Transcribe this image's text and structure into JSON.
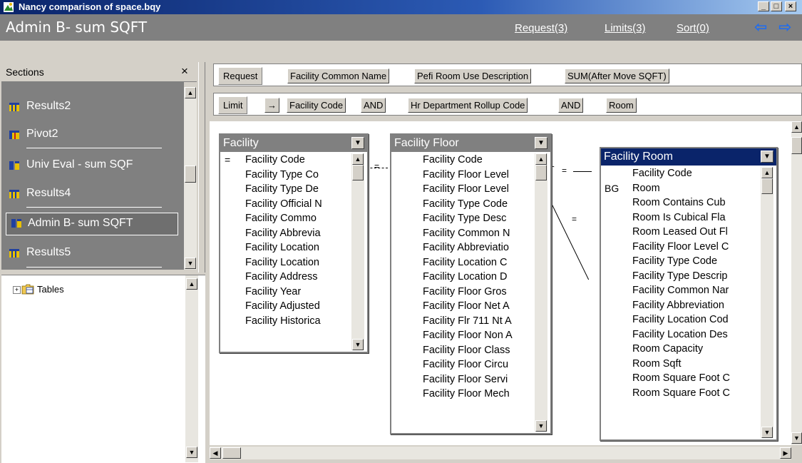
{
  "window": {
    "title": "Nancy comparison of space.bqy",
    "controls": {
      "minimize": "_",
      "maximize": "□",
      "close": "×"
    }
  },
  "header": {
    "title": "Admin B- sum SQFT",
    "links": {
      "request": "Request(3)",
      "limits": "Limits(3)",
      "sort": "Sort(0)"
    },
    "nav": {
      "back": "⇦",
      "forward": "⇨"
    }
  },
  "sections": {
    "title": "Sections",
    "close": "×",
    "items": [
      {
        "label": "Results2",
        "icon": "results-icon"
      },
      {
        "label": "Pivot2",
        "icon": "pivot-icon"
      },
      {
        "label": "Univ Eval - sum SQF",
        "icon": "query-icon"
      },
      {
        "label": "Results4",
        "icon": "results-icon"
      },
      {
        "label": "Admin B- sum SQFT",
        "icon": "query-icon",
        "selected": true
      },
      {
        "label": "Results5",
        "icon": "results-icon"
      }
    ]
  },
  "tree": {
    "expander": "+",
    "root": "Tables"
  },
  "request_bar": {
    "label": "Request",
    "items": [
      "Facility Common Name",
      "Pefi Room Use Description",
      "SUM(After Move SQFT)"
    ]
  },
  "limit_bar": {
    "label": "Limit",
    "arrow": "→",
    "items": [
      "Facility Code",
      "AND",
      "Hr Department Rollup Code",
      "AND",
      "Room"
    ]
  },
  "topics": {
    "facility": {
      "title": "Facility",
      "fields": [
        {
          "mark": "=",
          "name": "Facility Code"
        },
        {
          "mark": "",
          "name": "Facility Type Co"
        },
        {
          "mark": "",
          "name": "Facility Type De"
        },
        {
          "mark": "",
          "name": "Facility Official N"
        },
        {
          "mark": "",
          "name": "Facility Commo"
        },
        {
          "mark": "",
          "name": "Facility Abbrevia"
        },
        {
          "mark": "",
          "name": "Facility Location"
        },
        {
          "mark": "",
          "name": "Facility Location"
        },
        {
          "mark": "",
          "name": "Facility Address"
        },
        {
          "mark": "",
          "name": "Facility Year"
        },
        {
          "mark": "",
          "name": "Facility Adjusted"
        },
        {
          "mark": "",
          "name": "Facility Historica"
        }
      ]
    },
    "floor": {
      "title": "Facility Floor",
      "fields": [
        {
          "mark": "",
          "name": "Facility Code"
        },
        {
          "mark": "",
          "name": "Facility Floor Level"
        },
        {
          "mark": "",
          "name": "Facility Floor Level"
        },
        {
          "mark": "",
          "name": "Facility Type Code"
        },
        {
          "mark": "",
          "name": "Facility Type Desc"
        },
        {
          "mark": "",
          "name": "Facility Common N"
        },
        {
          "mark": "",
          "name": "Facility Abbreviatio"
        },
        {
          "mark": "",
          "name": "Facility Location C"
        },
        {
          "mark": "",
          "name": "Facility Location D"
        },
        {
          "mark": "",
          "name": "Facility Floor Gros"
        },
        {
          "mark": "",
          "name": "Facility Floor Net A"
        },
        {
          "mark": "",
          "name": "Facility Flr 711 Nt A"
        },
        {
          "mark": "",
          "name": "Facility Floor Non A"
        },
        {
          "mark": "",
          "name": "Facility Floor Class"
        },
        {
          "mark": "",
          "name": "Facility Floor Circu"
        },
        {
          "mark": "",
          "name": "Facility Floor Servi"
        },
        {
          "mark": "",
          "name": "Facility Floor Mech"
        }
      ]
    },
    "room": {
      "title": "Facility Room",
      "fields": [
        {
          "mark": "",
          "name": "Facility Code"
        },
        {
          "mark": "BG",
          "name": "Room"
        },
        {
          "mark": "",
          "name": "Room Contains Cub"
        },
        {
          "mark": "",
          "name": "Room Is Cubical Fla"
        },
        {
          "mark": "",
          "name": "Room Leased Out Fl"
        },
        {
          "mark": "",
          "name": "Facility Floor Level C"
        },
        {
          "mark": "",
          "name": "Facility Type Code"
        },
        {
          "mark": "",
          "name": "Facility Type Descrip"
        },
        {
          "mark": "",
          "name": "Facility Common Nar"
        },
        {
          "mark": "",
          "name": "Facility Abbreviation"
        },
        {
          "mark": "",
          "name": "Facility Location Cod"
        },
        {
          "mark": "",
          "name": "Facility Location Des"
        },
        {
          "mark": "",
          "name": "Room Capacity"
        },
        {
          "mark": "",
          "name": "Room Sqft"
        },
        {
          "mark": "",
          "name": "Room Square Foot C"
        },
        {
          "mark": "",
          "name": "Room Square Foot C"
        }
      ]
    }
  },
  "joins": {
    "marker": "="
  },
  "scroll_glyphs": {
    "up": "▲",
    "down": "▼",
    "left": "◀",
    "right": "▶",
    "dropdown": "▼"
  },
  "colors": {
    "accent": "#0a246a",
    "header_bg": "#808080",
    "nav_arrow": "#1e6cf0"
  }
}
